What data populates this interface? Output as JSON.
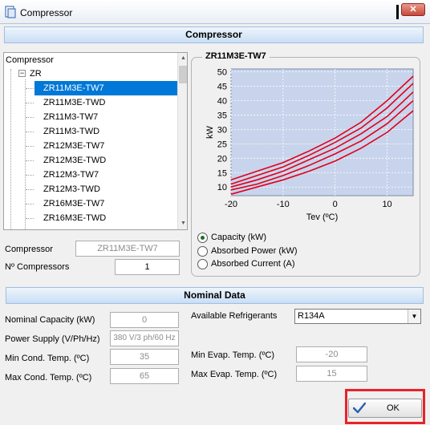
{
  "window": {
    "title": "Compressor",
    "close": "✕"
  },
  "sections": {
    "compressor": "Compressor",
    "nominal": "Nominal Data"
  },
  "tree": {
    "root": "Compressor",
    "group": "ZR",
    "items": [
      "ZR11M3E-TW7",
      "ZR11M3E-TWD",
      "ZR11M3-TW7",
      "ZR11M3-TWD",
      "ZR12M3E-TW7",
      "ZR12M3E-TWD",
      "ZR12M3-TW7",
      "ZR12M3-TWD",
      "ZR16M3E-TW7",
      "ZR16M3E-TWD"
    ],
    "selected_index": 0
  },
  "chart_panel": {
    "title": "ZR11M3E-TW7",
    "options": [
      "Capacity (kW)",
      "Absorbed Power (kW)",
      "Absorbed Current (A)"
    ],
    "selected_option": 0
  },
  "chart_data": {
    "type": "line",
    "xlabel": "Tev (ºC)",
    "ylabel": "kW",
    "xlim": [
      -20,
      15
    ],
    "ylim": [
      7,
      51
    ],
    "xticks": [
      -20,
      -10,
      0,
      10
    ],
    "yticks": [
      10,
      15,
      20,
      25,
      30,
      35,
      40,
      45,
      50
    ],
    "grid": true,
    "line_color": "#e0001a",
    "background": "#c8d4ec",
    "series": [
      {
        "x": [
          -20,
          -15,
          -10,
          -5,
          0,
          5,
          10,
          15
        ],
        "values": [
          12.5,
          15.5,
          18.5,
          22.5,
          27,
          32.5,
          40,
          48.5
        ]
      },
      {
        "x": [
          -20,
          -15,
          -10,
          -5,
          0,
          5,
          10,
          15
        ],
        "values": [
          11,
          14,
          17,
          21,
          25.5,
          30.5,
          37.5,
          46
        ]
      },
      {
        "x": [
          -20,
          -15,
          -10,
          -5,
          0,
          5,
          10,
          15
        ],
        "values": [
          10,
          12.5,
          15.5,
          19.5,
          23.5,
          28.5,
          34.5,
          43
        ]
      },
      {
        "x": [
          -20,
          -15,
          -10,
          -5,
          0,
          5,
          10,
          15
        ],
        "values": [
          9,
          11,
          14,
          17.5,
          21.5,
          26,
          32,
          40
        ]
      },
      {
        "x": [
          -20,
          -15,
          -10,
          -5,
          0,
          5,
          10,
          15
        ],
        "values": [
          7.5,
          10,
          12.5,
          15.5,
          19,
          23.5,
          29,
          36.5
        ]
      }
    ]
  },
  "form": {
    "compressor_label": "Compressor",
    "compressor_value": "ZR11M3E-TW7",
    "n_compressors_label": "Nº Compressors",
    "n_compressors_value": "1"
  },
  "nominal": {
    "capacity_label": "Nominal Capacity (kW)",
    "capacity_value": "0",
    "power_supply_label": "Power Supply (V/Ph/Hz)",
    "power_supply_value": "380 V/3 ph/60 Hz",
    "min_cond_label": "Min Cond. Temp. (ºC)",
    "min_cond_value": "35",
    "max_cond_label": "Max Cond. Temp. (ºC)",
    "max_cond_value": "65",
    "refrigerants_label": "Available Refrigerants",
    "refrigerant_value": "R134A",
    "min_evap_label": "Min Evap. Temp. (ºC)",
    "min_evap_value": "-20",
    "max_evap_label": "Max Evap. Temp. (ºC)",
    "max_evap_value": "15"
  },
  "buttons": {
    "ok": "OK"
  }
}
